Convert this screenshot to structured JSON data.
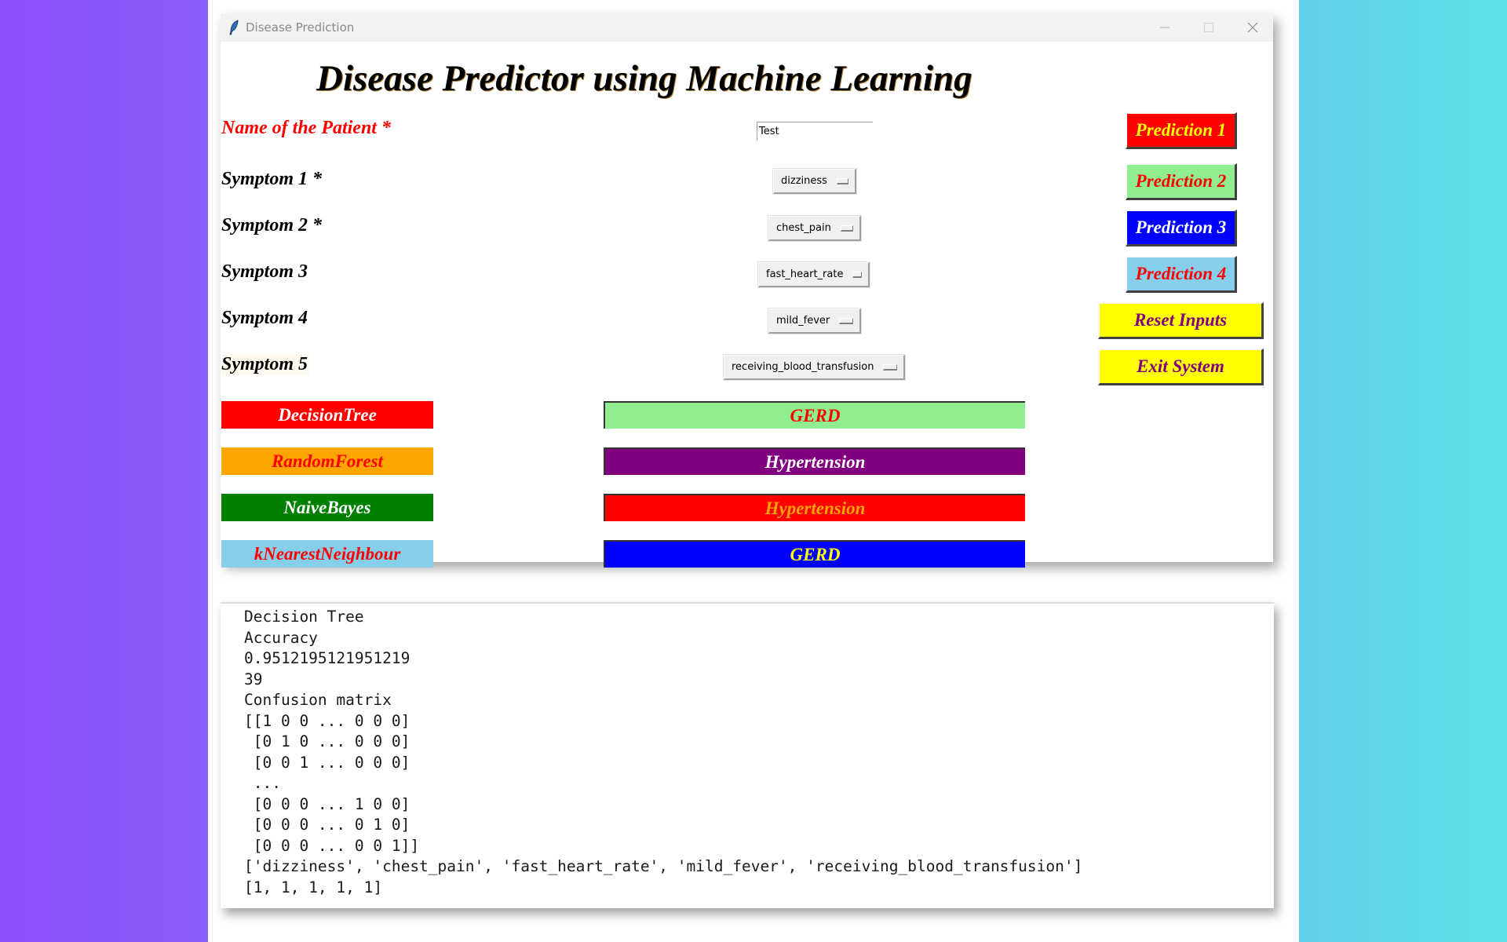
{
  "window": {
    "title": "Disease Prediction",
    "icon": "feather-icon",
    "controls": [
      "minimize-icon",
      "maximize-icon",
      "close-icon"
    ]
  },
  "form": {
    "heading": "Disease Predictor using Machine Learning",
    "name_label": "Name of the Patient *",
    "name_value": "Test",
    "symptoms": [
      {
        "label": "Symptom 1 *",
        "value": "dizziness"
      },
      {
        "label": "Symptom 2 *",
        "value": "chest_pain"
      },
      {
        "label": "Symptom 3",
        "value": "fast_heart_rate"
      },
      {
        "label": "Symptom 4",
        "value": "mild_fever"
      },
      {
        "label": "Symptom 5",
        "value": "receiving_blood_transfusion"
      }
    ]
  },
  "buttons": [
    {
      "label": "Prediction 1",
      "bg": "#ff0000",
      "fg": "#ffff00"
    },
    {
      "label": "Prediction 2",
      "bg": "#90ee90",
      "fg": "#ff0000"
    },
    {
      "label": "Prediction 3",
      "bg": "#0000ff",
      "fg": "#ffffff"
    },
    {
      "label": "Prediction 4",
      "bg": "#87ceeb",
      "fg": "#ff0000"
    },
    {
      "label": "Reset Inputs",
      "bg": "#ffff00",
      "fg": "#800080"
    },
    {
      "label": "Exit System",
      "bg": "#ffff00",
      "fg": "#800080"
    }
  ],
  "algorithms": [
    {
      "label": "DecisionTree",
      "bg": "#ff0000",
      "fg": "#ffffff",
      "result": "GERD",
      "result_bg": "#90ee90",
      "result_fg": "#ff0000"
    },
    {
      "label": "RandomForest",
      "bg": "#ffa500",
      "fg": "#ff0000",
      "result": "Hypertension",
      "result_bg": "#800080",
      "result_fg": "#ffffff"
    },
    {
      "label": "NaiveBayes",
      "bg": "#008000",
      "fg": "#ffffff",
      "result": "Hypertension",
      "result_bg": "#ff0000",
      "result_fg": "#ffa500"
    },
    {
      "label": "kNearestNeighbour",
      "bg": "#87ceeb",
      "fg": "#ff0000",
      "result": "GERD",
      "result_bg": "#0000ff",
      "result_fg": "#ffff00"
    }
  ],
  "console": {
    "lines": [
      "Decision Tree",
      "Accuracy",
      "0.9512195121951219",
      "39",
      "Confusion matrix",
      "[[1 0 0 ... 0 0 0]",
      " [0 1 0 ... 0 0 0]",
      " [0 0 1 ... 0 0 0]",
      " ...",
      " [0 0 0 ... 1 0 0]",
      " [0 0 0 ... 0 1 0]",
      " [0 0 0 ... 0 0 1]]",
      "['dizziness', 'chest_pain', 'fast_heart_rate', 'mild_fever', 'receiving_blood_transfusion']",
      "[1, 1, 1, 1, 1]"
    ]
  }
}
